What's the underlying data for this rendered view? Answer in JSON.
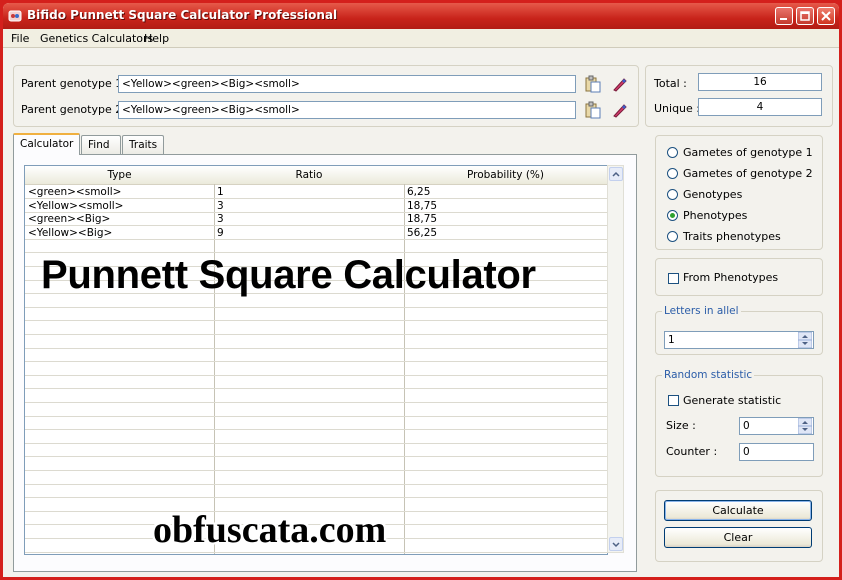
{
  "window": {
    "title": "Bifido Punnett Square Calculator Professional"
  },
  "menu": [
    "File",
    "Genetics Calculators",
    "Help"
  ],
  "parents": {
    "p1_label": "Parent genotype 1 :",
    "p1_value": "<Yellow><green><Big><smoll>",
    "p2_label": "Parent genotype 2 :",
    "p2_value": "<Yellow><green><Big><smoll>"
  },
  "tabs": [
    "Calculator",
    "Find",
    "Traits"
  ],
  "table": {
    "headers": [
      "Type",
      "Ratio",
      "Probability (%)"
    ],
    "rows": [
      [
        "<green><smoll>",
        "1",
        "6,25"
      ],
      [
        "<Yellow><smoll>",
        "3",
        "18,75"
      ],
      [
        "<green><Big>",
        "3",
        "18,75"
      ],
      [
        "<Yellow><Big>",
        "9",
        "56,25"
      ]
    ]
  },
  "stats": {
    "total_label": "Total :",
    "total_value": "16",
    "unique_label": "Unique :",
    "unique_value": "4"
  },
  "radio_options": [
    {
      "label": "Gametes of genotype 1",
      "selected": false
    },
    {
      "label": "Gametes of genotype 2",
      "selected": false
    },
    {
      "label": "Genotypes",
      "selected": false
    },
    {
      "label": "Phenotypes",
      "selected": true
    },
    {
      "label": "Traits phenotypes",
      "selected": false
    }
  ],
  "from_phenotypes": {
    "label": "From Phenotypes",
    "checked": false
  },
  "letters_in_allel": {
    "title": "Letters in allel",
    "value": "1"
  },
  "random_statistic": {
    "title": "Random statistic",
    "generate_label": "Generate statistic",
    "generate_checked": false,
    "size_label": "Size :",
    "size_value": "0",
    "counter_label": "Counter :",
    "counter_value": "0"
  },
  "buttons": {
    "calculate": "Calculate",
    "clear": "Clear"
  },
  "overlay": {
    "title": "Punnett Square Calculator",
    "watermark": "obfuscata.com"
  },
  "colors": {
    "titlebar": "#c8231a",
    "frame": "#d4201c",
    "accent_text": "#2b5da8"
  }
}
